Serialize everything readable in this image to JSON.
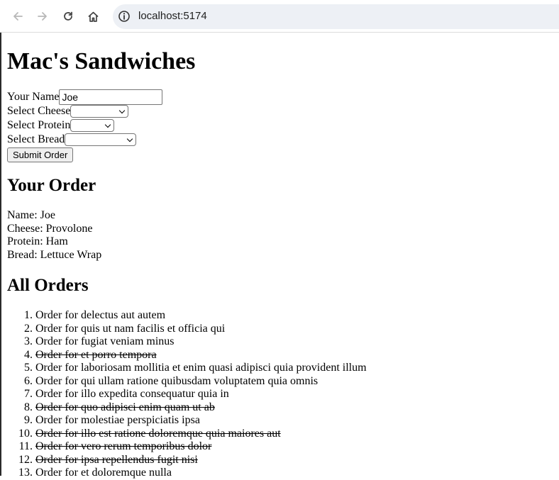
{
  "browser": {
    "url": "localhost:5174"
  },
  "page": {
    "title": "Mac's Sandwiches",
    "form": {
      "name_label": "Your Name",
      "name_value": "Joe",
      "cheese_label": "Select Cheese",
      "cheese_value": "",
      "protein_label": "Select Protein",
      "protein_value": "",
      "bread_label": "Select Bread",
      "bread_value": "",
      "submit_label": "Submit Order"
    },
    "your_order": {
      "heading": "Your Order",
      "name": "Name: Joe",
      "cheese": "Cheese: Provolone",
      "protein": "Protein: Ham",
      "bread": "Bread: Lettuce Wrap"
    },
    "all_orders": {
      "heading": "All Orders",
      "items": [
        {
          "text": "Order for delectus aut autem",
          "done": false
        },
        {
          "text": "Order for quis ut nam facilis et officia qui",
          "done": false
        },
        {
          "text": "Order for fugiat veniam minus",
          "done": false
        },
        {
          "text": "Order for et porro tempora",
          "done": true
        },
        {
          "text": "Order for laboriosam mollitia et enim quasi adipisci quia provident illum",
          "done": false
        },
        {
          "text": "Order for qui ullam ratione quibusdam voluptatem quia omnis",
          "done": false
        },
        {
          "text": "Order for illo expedita consequatur quia in",
          "done": false
        },
        {
          "text": "Order for quo adipisci enim quam ut ab",
          "done": true
        },
        {
          "text": "Order for molestiae perspiciatis ipsa",
          "done": false
        },
        {
          "text": "Order for illo est ratione doloremque quia maiores aut",
          "done": true
        },
        {
          "text": "Order for vero rerum temporibus dolor",
          "done": true
        },
        {
          "text": "Order for ipsa repellendus fugit nisi",
          "done": true
        },
        {
          "text": "Order for et doloremque nulla",
          "done": false
        }
      ]
    }
  }
}
